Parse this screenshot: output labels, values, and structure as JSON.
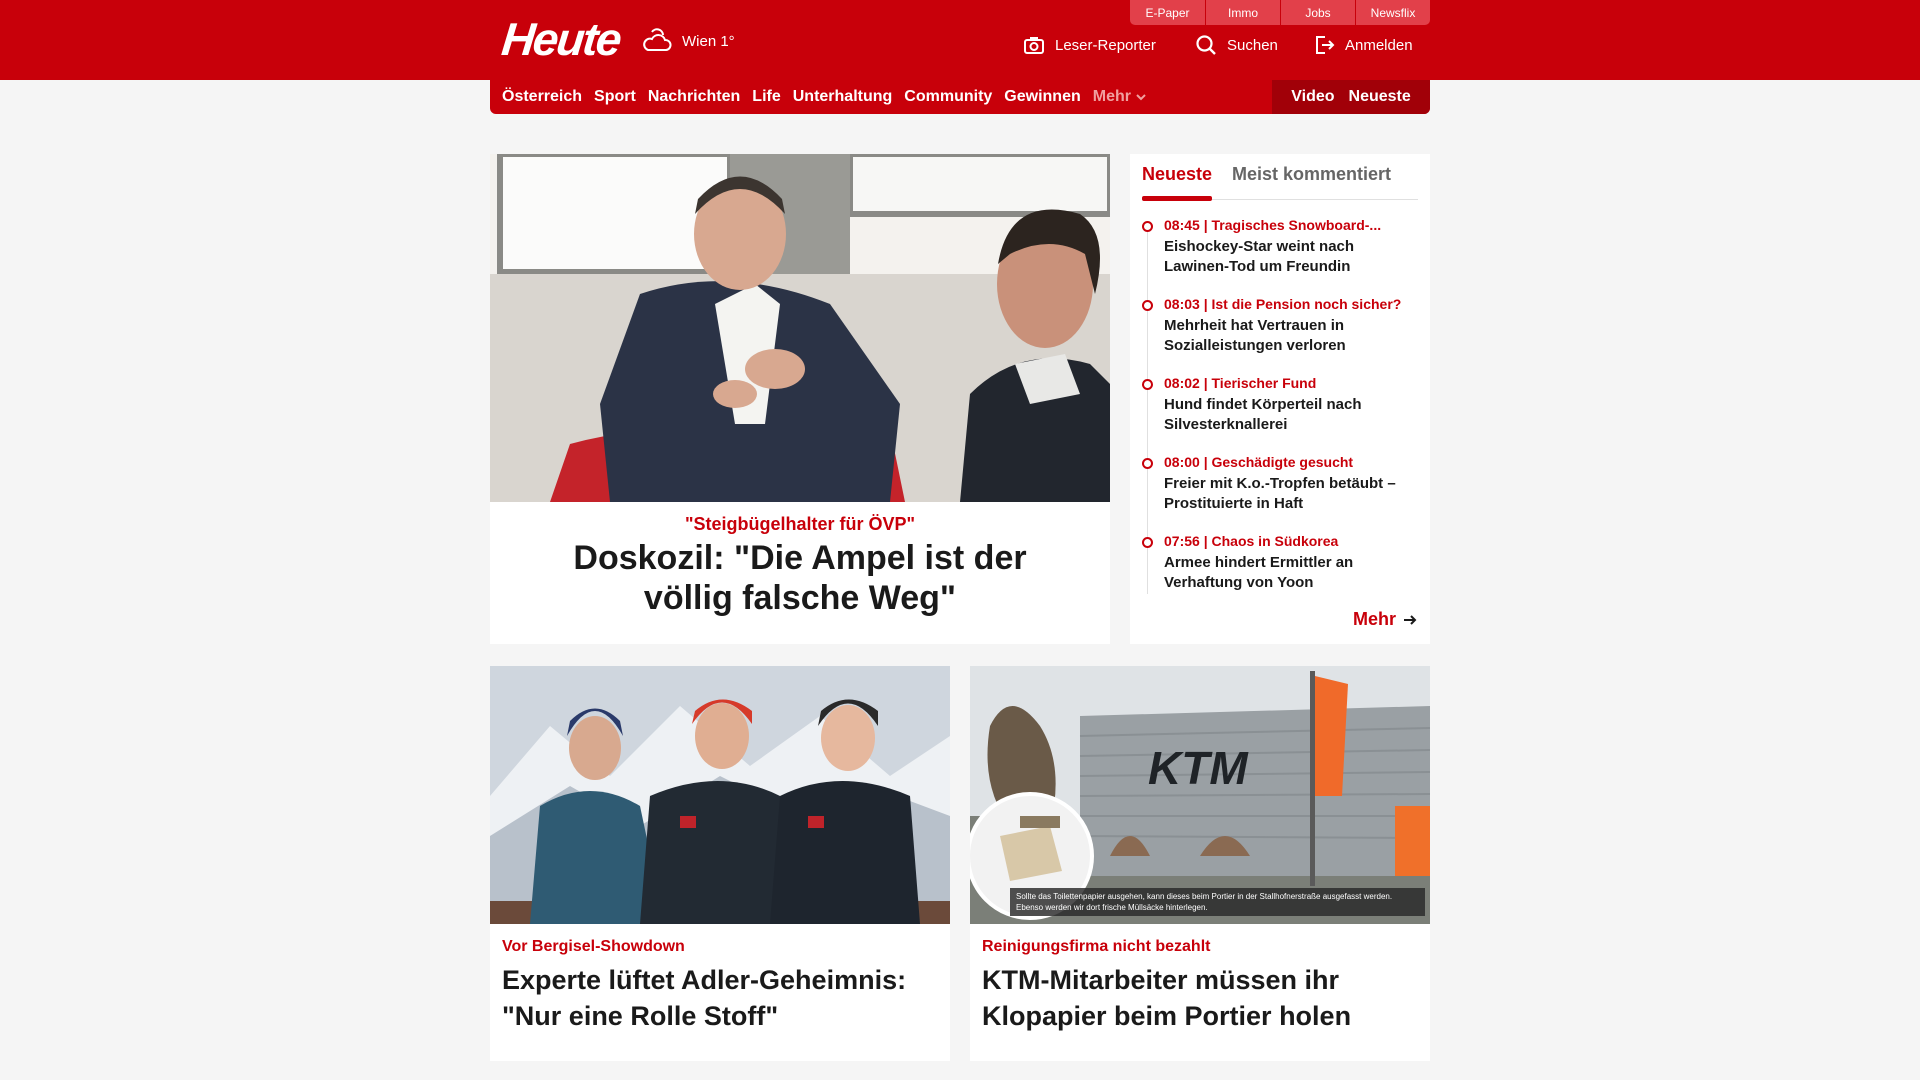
{
  "header": {
    "logo": "Heute",
    "weather": "Wien 1°",
    "quicklinks": [
      "E-Paper",
      "Immo",
      "Jobs",
      "Newsflix"
    ],
    "reporter_label": "Leser-Reporter",
    "search_label": "Suchen",
    "login_label": "Anmelden"
  },
  "nav": {
    "items": [
      "Österreich",
      "Sport",
      "Nachrichten",
      "Life",
      "Unterhaltung",
      "Community",
      "Gewinnen"
    ],
    "more_label": "Mehr",
    "video_label": "Video",
    "latest_label": "Neueste"
  },
  "lead": {
    "kicker": "\"Steigbügelhalter für ÖVP\"",
    "title": "Doskozil: \"Die Ampel ist der völlig falsche Weg\""
  },
  "sidebar": {
    "tab_active": "Neueste",
    "tab_other": "Meist kommentiert",
    "items": [
      {
        "kicker": "08:45 | Tragisches Snowboard-...",
        "title": "Eishockey-Star weint nach Lawinen-Tod um Freundin"
      },
      {
        "kicker": "08:03 | Ist die Pension noch sicher?",
        "title": "Mehrheit hat Vertrauen in Sozialleistungen verloren"
      },
      {
        "kicker": "08:02 | Tierischer Fund",
        "title": "Hund findet Körperteil nach Silvesterknallerei"
      },
      {
        "kicker": "08:00 | Geschädigte gesucht",
        "title": "Freier mit K.o.-Tropfen betäubt – Prostituierte in Haft"
      },
      {
        "kicker": "07:56 | Chaos in Südkorea",
        "title": "Armee hindert Ermittler an Verhaftung von Yoon"
      }
    ],
    "more_label": "Mehr"
  },
  "cards": [
    {
      "kicker": "Vor Bergisel-Showdown",
      "title": "Experte lüftet Adler-Geheimnis: \"Nur eine Rolle Stoff\""
    },
    {
      "kicker": "Reinigungsfirma nicht bezahlt",
      "title": "KTM-Mitarbeiter müssen ihr Klopapier beim Portier holen",
      "caption": "Sollte das Toilettenpapier ausgehen, kann dieses beim Portier in der Stallhofnerstraße ausgefasst werden. Ebenso werden wir dort frische Müllsäcke hinterlegen.",
      "sign": "KTM"
    }
  ],
  "colors": {
    "brand": "#c8000a",
    "nav_dark": "#a10008",
    "quicklink": "#e2404a"
  },
  "icons": [
    "weather-cloud-sun-icon",
    "camera-icon",
    "search-icon",
    "login-icon",
    "chevron-down-icon",
    "arrow-right-icon"
  ]
}
